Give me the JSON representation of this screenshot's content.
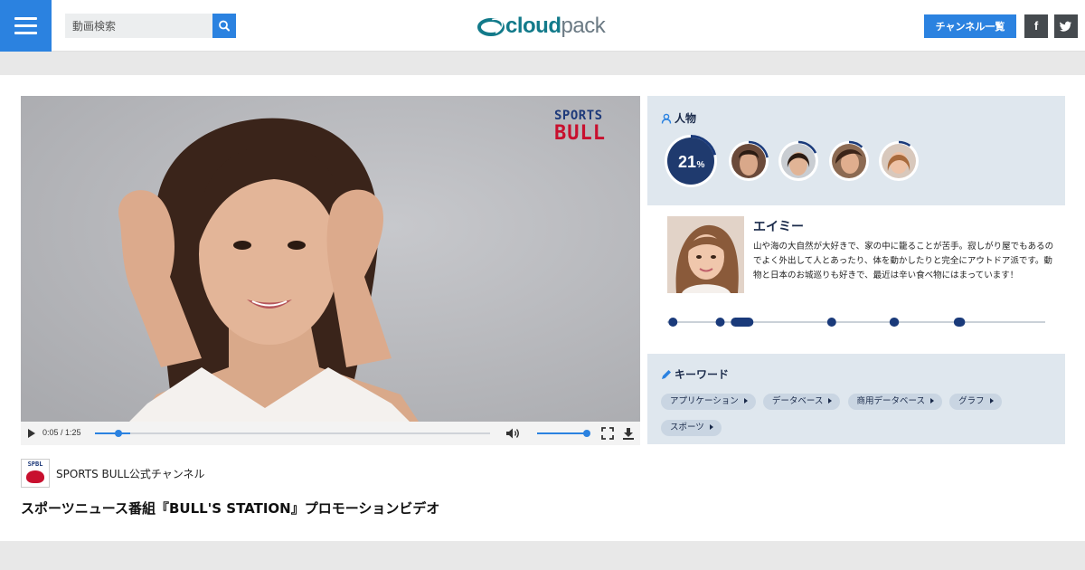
{
  "header": {
    "search_placeholder": "動画検索",
    "logo_bold": "cloud",
    "logo_light": "pack",
    "channels_label": "チャンネル一覧",
    "facebook_label": "f",
    "twitter_label": "t"
  },
  "player": {
    "overlay_top": "SPORTS",
    "overlay_bottom": "BULL",
    "time": "0:05 / 1:25",
    "progress": 0.0588,
    "volume": 1.0
  },
  "channel": {
    "logo_text": "SPBL",
    "name": "SPORTS BULL公式チャンネル"
  },
  "video_title": "スポーツニュース番組『BULL'S STATION』プロモーションビデオ",
  "people": {
    "heading": "人物",
    "main_percent_value": "21",
    "main_percent_unit": "%",
    "main_percent": 0.21,
    "others": [
      {
        "progress": 0.22
      },
      {
        "progress": 0.18
      },
      {
        "progress": 0.12
      },
      {
        "progress": 0.1
      }
    ]
  },
  "profile": {
    "name": "エイミー",
    "description": "山や海の大自然が大好きで、家の中に籠ることが苦手。寂しがり屋でもあるのでよく外出して人とあったり、体を動かしたりと完全にアウトドア派です。動物と日本のお城巡りも好きで、最近は辛い食べ物にはまっています！",
    "timeline_segments": [
      {
        "start": 0.015,
        "end": 0.025
      },
      {
        "start": 0.14,
        "end": 0.15
      },
      {
        "start": 0.18,
        "end": 0.24
      },
      {
        "start": 0.435,
        "end": 0.445
      },
      {
        "start": 0.6,
        "end": 0.625
      },
      {
        "start": 0.77,
        "end": 0.8
      }
    ]
  },
  "keywords": {
    "heading": "キーワード",
    "tags": [
      "アプリケーション",
      "データベース",
      "商用データベース",
      "グラフ",
      "スポーツ"
    ]
  },
  "colors": {
    "accent": "#2b82e0",
    "navy": "#1a3a7a",
    "panel": "#dfe7ee"
  }
}
